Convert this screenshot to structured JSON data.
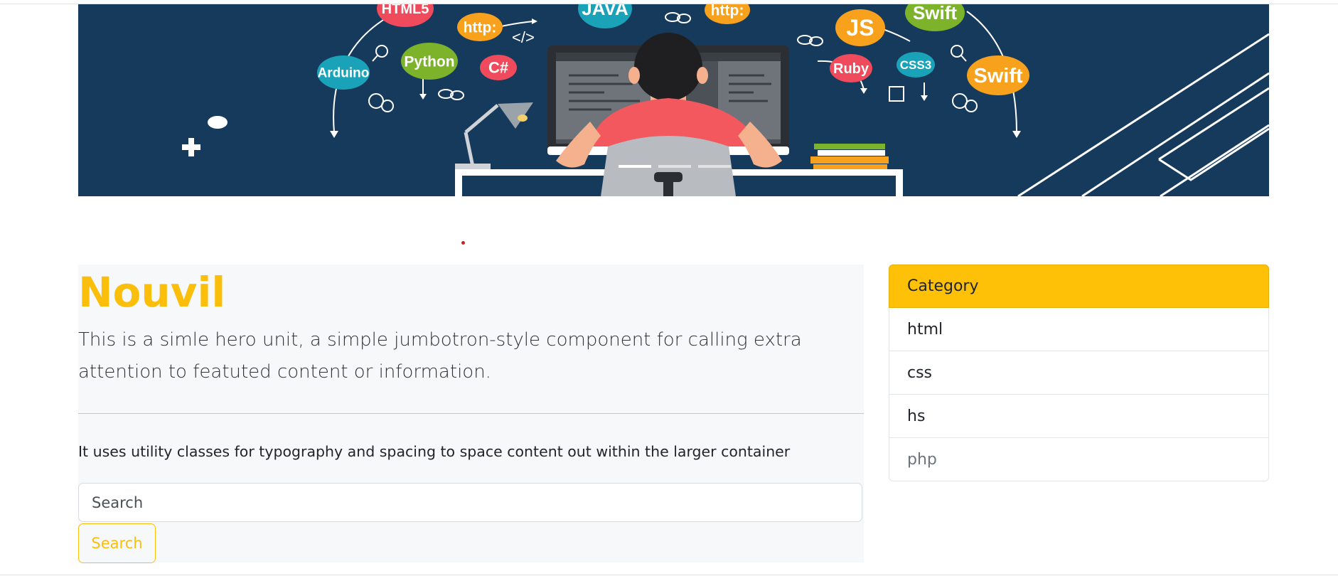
{
  "banner": {
    "bubbles": [
      {
        "label": "HTML5",
        "color": "#ef4b5c"
      },
      {
        "label": "http:",
        "color": "#f7a11d"
      },
      {
        "label": "JAVA",
        "color": "#1aa3b8"
      },
      {
        "label": "http:",
        "color": "#f7a11d"
      },
      {
        "label": "JS",
        "color": "#f7a11d"
      },
      {
        "label": "Swift",
        "color": "#7cb32b"
      },
      {
        "label": "Arduino",
        "color": "#1aa3b8"
      },
      {
        "label": "Python",
        "color": "#7cb32b"
      },
      {
        "label": "C#",
        "color": "#ef4b5c"
      },
      {
        "label": "Ruby",
        "color": "#ef4b5c"
      },
      {
        "label": "CSS3",
        "color": "#1aa3b8"
      },
      {
        "label": "Swift",
        "color": "#f7a11d"
      }
    ],
    "code_tag": "</>",
    "background_color": "#163a5c"
  },
  "jumbotron": {
    "title": "Nouvil",
    "lead": "This is a simle hero unit, a simple jumbotron-style component for calling extra attention to featuted content or information.",
    "text": "It uses utility classes for typography and spacing to space content out within the larger container",
    "search_placeholder": "Search",
    "search_button": "Search"
  },
  "category": {
    "header": "Category",
    "items": [
      "html",
      "css",
      "hs",
      "php"
    ]
  },
  "colors": {
    "accent": "#fbbf0b",
    "category_header": "#fec107"
  }
}
